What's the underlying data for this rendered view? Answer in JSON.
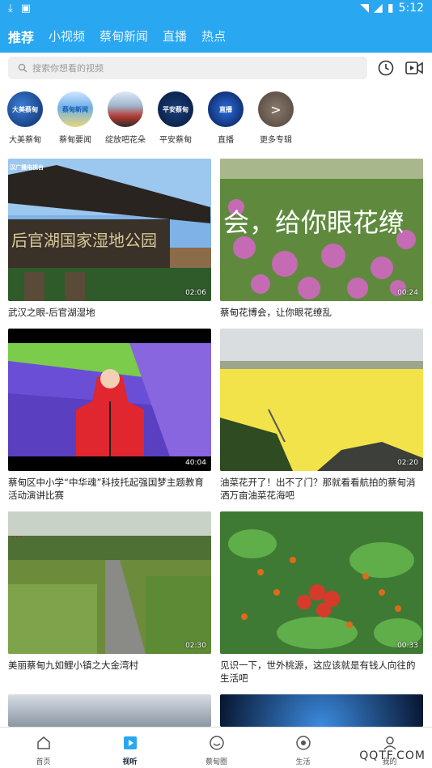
{
  "status_bar": {
    "time": "5:12",
    "icons": [
      "download-icon",
      "notification-a-icon",
      "wifi-icon",
      "signal-icon",
      "battery-icon"
    ]
  },
  "top_tabs": [
    {
      "label": "推荐",
      "active": true
    },
    {
      "label": "小视频",
      "active": false
    },
    {
      "label": "蔡甸新闻",
      "active": false
    },
    {
      "label": "直播",
      "active": false
    },
    {
      "label": "热点",
      "active": false
    }
  ],
  "search": {
    "placeholder": "搜索你想看的视频"
  },
  "channels": [
    {
      "label": "大美蔡甸",
      "badge": "大美蔡甸"
    },
    {
      "label": "蔡甸要闻",
      "badge": "蔡甸新闻"
    },
    {
      "label": "绽放吧花朵",
      "badge": ""
    },
    {
      "label": "平安蔡甸",
      "badge": "平安蔡甸"
    },
    {
      "label": "直播",
      "badge": "直播"
    },
    {
      "label": "更多专辑",
      "badge": ">"
    }
  ],
  "videos": [
    {
      "title": "武汉之眼-后官湖湿地",
      "duration": "02:06",
      "overlay": "后官湖国家湿地公园",
      "corner": "汉广播电视台"
    },
    {
      "title": "蔡甸花博会，让你眼花缭乱",
      "duration": "00:24",
      "overlay": "会，给你眼花缭"
    },
    {
      "title": "蔡甸区中小学“中华魂”科技托起强国梦主题教育活动演讲比赛",
      "duration": "40:04"
    },
    {
      "title": "油菜花开了！出不了门？那就看看航拍的蔡甸消洒万亩油菜花海吧",
      "duration": "02:20"
    },
    {
      "title": "美丽蔡甸九如鲤小镇之大金湾村",
      "duration": "02:30"
    },
    {
      "title": "见识一下，世外桃源，这应该就是有钱人向往的生活吧",
      "duration": "00:33"
    }
  ],
  "bottom_nav": [
    {
      "label": "首页",
      "active": false
    },
    {
      "label": "视听",
      "active": true
    },
    {
      "label": "蔡甸圈",
      "active": false
    },
    {
      "label": "生活",
      "active": false
    },
    {
      "label": "我的",
      "active": false
    }
  ],
  "watermark": "QQTF.COM",
  "colors": {
    "accent": "#29a7f0",
    "tab_active": "#ffffff"
  }
}
